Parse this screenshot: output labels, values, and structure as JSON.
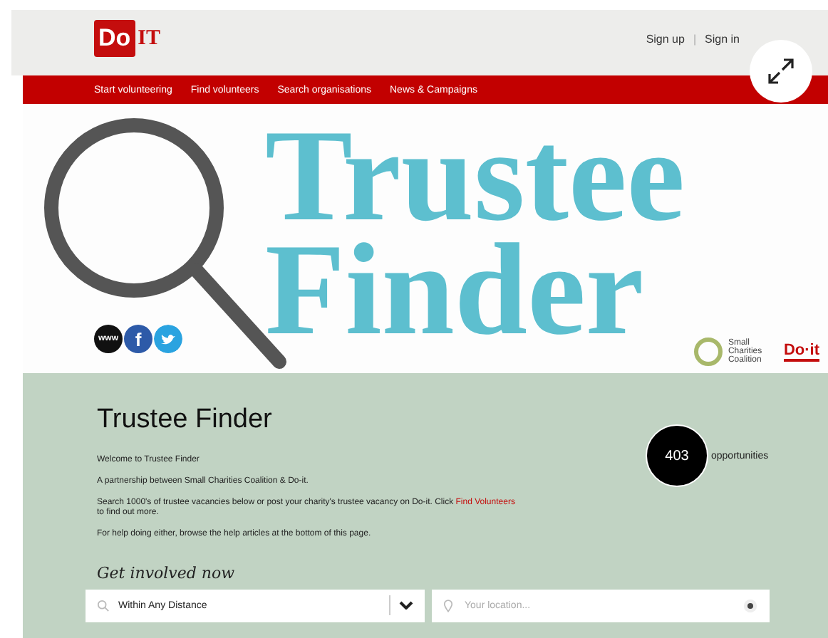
{
  "header": {
    "logo_badge": "Do",
    "logo_suffix": "IT",
    "account_links": [
      {
        "label": "Sign up"
      },
      {
        "label": "Sign in"
      }
    ],
    "separator": "|"
  },
  "nav": [
    {
      "label": "Start volunteering"
    },
    {
      "label": "Find volunteers"
    },
    {
      "label": "Search organisations"
    },
    {
      "label": "News & Campaigns"
    }
  ],
  "banner": {
    "title_lines": [
      "Trustee",
      "Finder"
    ],
    "social": [
      {
        "kind": "www",
        "label": "www"
      },
      {
        "kind": "facebook",
        "label": "f"
      },
      {
        "kind": "twitter"
      }
    ],
    "partner_text": "Small Charities Coalition",
    "partner_logo": "Do·it"
  },
  "main": {
    "heading": "Trustee Finder",
    "paragraphs": [
      {
        "text": "Welcome to Trustee Finder"
      },
      {
        "text": "A partnership between Small Charities Coalition & Do-it."
      },
      {
        "text": "Search 1000's of trustee vacancies below or post your charity's trustee vacancy on Do-it. Click ",
        "link": "Find Volunteers",
        "after": " to find out more."
      },
      {
        "text": "For help doing either, browse the help articles at the bottom of this page."
      }
    ],
    "count": "403",
    "count_label": "opportunities",
    "cta": "Get involved now",
    "distance_select": {
      "value": "Within Any Distance"
    },
    "location_field": {
      "placeholder": "Your location..."
    }
  }
}
